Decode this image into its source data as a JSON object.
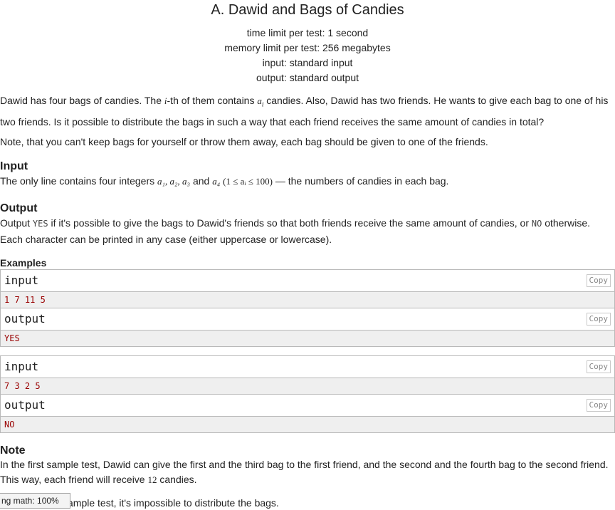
{
  "problem": {
    "title": "A. Dawid and Bags of Candies",
    "time_limit": "time limit per test: 1 second",
    "memory_limit": "memory limit per test: 256 megabytes",
    "input": "input: standard input",
    "output": "output: standard output"
  },
  "statement": {
    "p1_a": "Dawid has four bags of candies. The ",
    "p1_i": "i",
    "p1_b": "-th of them contains ",
    "p1_ai": "a",
    "p1_ai_sub": "i",
    "p1_c": " candies. Also, Dawid has two friends. He wants to give each bag to one of his two friends. Is it possible to distribute the bags in such a way that each friend receives the same amount of candies in total?",
    "p2": "Note, that you can't keep bags for yourself or throw them away, each bag should be given to one of the friends."
  },
  "input_section": {
    "title": "Input",
    "text_a": "The only line contains four integers ",
    "vars": "a₁, a₂, a₃",
    "text_and": " and ",
    "var4": "a₄",
    "constraint": "(1 ≤ aᵢ ≤ 100)",
    "text_b": " — the numbers of candies in each bag."
  },
  "output_section": {
    "title": "Output",
    "text_a": "Output ",
    "yes": "YES",
    "text_b": " if it's possible to give the bags to Dawid's friends so that both friends receive the same amount of candies, or ",
    "no": "NO",
    "text_c": " otherwise. Each character can be printed in any case (either uppercase or lowercase)."
  },
  "examples": {
    "title": "Examples",
    "copy_label": "Copy",
    "input_label": "input",
    "output_label": "output",
    "items": [
      {
        "input": "1 7 11 5",
        "output": "YES"
      },
      {
        "input": "7 3 2 5",
        "output": "NO"
      }
    ]
  },
  "note": {
    "title": "Note",
    "p1_a": "In the first sample test, Dawid can give the first and the third bag to the first friend, and the second and the fourth bag to the second friend. This way, each friend will receive ",
    "p1_num": "12",
    "p1_b": " candies.",
    "p2_visible": "ample test, it's impossible to distribute the bags."
  },
  "mathjax_tooltip": "ng math: 100%"
}
